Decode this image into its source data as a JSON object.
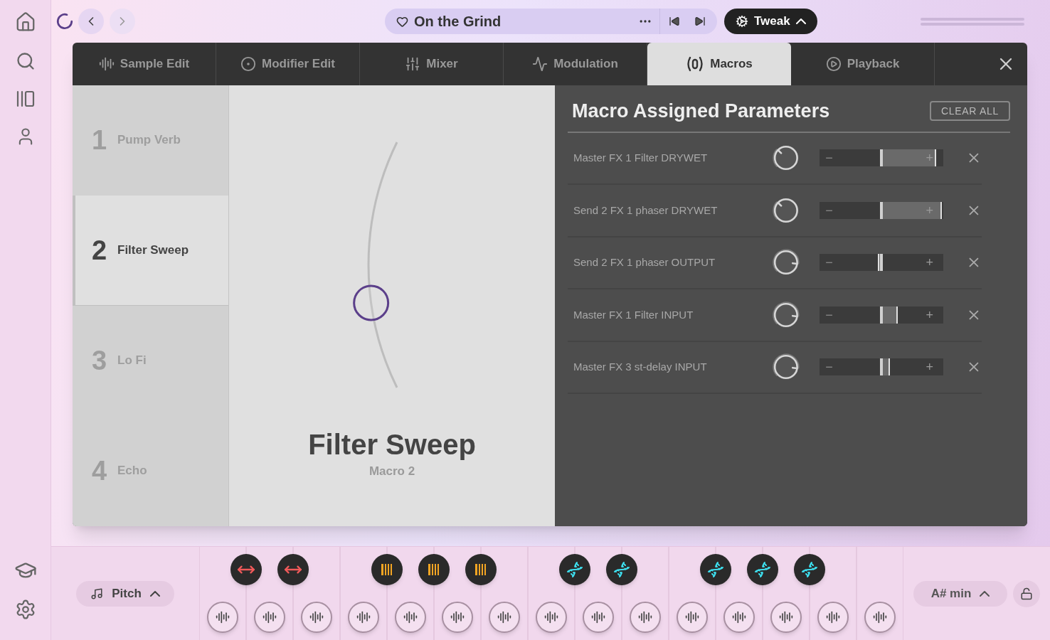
{
  "top_bar": {
    "title": "On the Grind",
    "tweak_label": "Tweak"
  },
  "tabs": [
    {
      "label": "Sample Edit",
      "selected": false
    },
    {
      "label": "Modifier Edit",
      "selected": false
    },
    {
      "label": "Mixer",
      "selected": false
    },
    {
      "label": "Modulation",
      "selected": false
    },
    {
      "label": "Macros",
      "selected": true
    },
    {
      "label": "Playback",
      "selected": false
    }
  ],
  "macros": [
    {
      "number": "1",
      "name": "Pump Verb",
      "selected": false
    },
    {
      "number": "2",
      "name": "Filter Sweep",
      "selected": true
    },
    {
      "number": "3",
      "name": "Lo Fi",
      "selected": false
    },
    {
      "number": "4",
      "name": "Echo",
      "selected": false
    }
  ],
  "macro_view": {
    "title": "Filter Sweep",
    "subtitle": "Macro 2",
    "level": 0.35
  },
  "parameters": {
    "title": "Macro Assigned Parameters",
    "clear_label": "CLEAR ALL",
    "minus": "−",
    "plus": "+",
    "rows": [
      {
        "name": "Master FX 1 Filter DRYWET",
        "knob": {
          "turned_up": false
        },
        "range": {
          "level": 0.94
        }
      },
      {
        "name": "Send 2 FX 1 phaser DRYWET",
        "knob": {
          "turned_up": false
        },
        "range": {
          "level": 0.99
        }
      },
      {
        "name": "Send 2 FX 1 phaser OUTPUT",
        "knob": {
          "turned_up": true
        },
        "range": {
          "level": 0.48
        }
      },
      {
        "name": "Master FX 1 Filter INPUT",
        "knob": {
          "turned_up": true
        },
        "range": {
          "level": 0.63
        }
      },
      {
        "name": "Master FX 3 st-delay INPUT",
        "knob": {
          "turned_up": true
        },
        "range": {
          "level": 0.57
        }
      }
    ]
  },
  "keyboard": {
    "pitch_label": "Pitch",
    "scale_label": "A# min",
    "black_keys": [
      {
        "kind": "stretch"
      },
      {
        "kind": "stretch"
      },
      {
        "kind": "bars"
      },
      {
        "kind": "bars"
      },
      {
        "kind": "bars"
      },
      {
        "kind": "dna"
      },
      {
        "kind": "dna"
      },
      {
        "kind": "dna"
      },
      {
        "kind": "dna"
      },
      {
        "kind": "dna"
      }
    ]
  }
}
